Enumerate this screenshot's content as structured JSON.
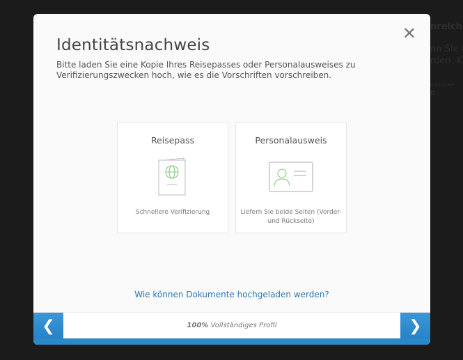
{
  "background": {
    "lines": [
      "nreichen",
      "nn Sie u",
      "rden, K",
      "maximale",
      "B"
    ]
  },
  "modal": {
    "title": "Identitätsnachweis",
    "description": "Bitte laden Sie eine Kopie Ihres Reisepasses oder Personalausweises zu Verifizierungszwecken hoch, wie es die Vorschriften vorschreiben.",
    "close_icon": "close-icon",
    "options": [
      {
        "title": "Reisepass",
        "subtitle": "Schnellere Verifizierung",
        "icon": "passport-icon"
      },
      {
        "title": "Personalausweis",
        "subtitle": "Liefern Sie beide Seiten (Vorder- und Rückseite)",
        "icon": "id-card-icon"
      }
    ],
    "help_link": "Wie können Dokumente hochgeladen werden?",
    "footer": {
      "progress_value": "100%",
      "progress_label": "Vollständiges Profil",
      "prev_icon": "chevron-left-icon",
      "next_icon": "chevron-right-icon"
    },
    "accent": "#2b88cb",
    "icon_green": "#7cc576"
  }
}
